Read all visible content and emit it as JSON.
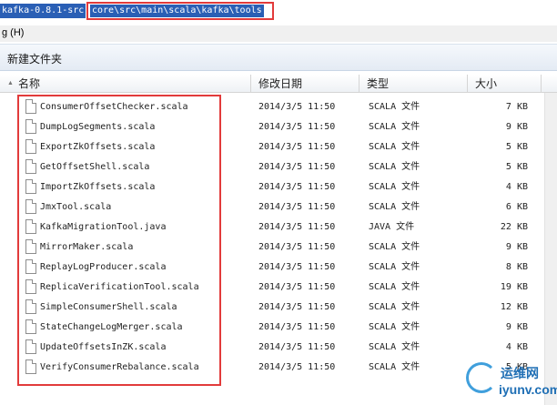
{
  "address_bar": {
    "path_prefix": "kafka-0.8.1-src",
    "path_highlight": "core\\src\\main\\scala\\kafka\\tools"
  },
  "menubar": {
    "help_label": "g (H)"
  },
  "toolbar": {
    "new_folder_label": "新建文件夹"
  },
  "columns": {
    "name": "名称",
    "date": "修改日期",
    "type": "类型",
    "size": "大小"
  },
  "files": [
    {
      "name": "ConsumerOffsetChecker.scala",
      "date": "2014/3/5 11:50",
      "type": "SCALA 文件",
      "size": "7 KB"
    },
    {
      "name": "DumpLogSegments.scala",
      "date": "2014/3/5 11:50",
      "type": "SCALA 文件",
      "size": "9 KB"
    },
    {
      "name": "ExportZkOffsets.scala",
      "date": "2014/3/5 11:50",
      "type": "SCALA 文件",
      "size": "5 KB"
    },
    {
      "name": "GetOffsetShell.scala",
      "date": "2014/3/5 11:50",
      "type": "SCALA 文件",
      "size": "5 KB"
    },
    {
      "name": "ImportZkOffsets.scala",
      "date": "2014/3/5 11:50",
      "type": "SCALA 文件",
      "size": "4 KB"
    },
    {
      "name": "JmxTool.scala",
      "date": "2014/3/5 11:50",
      "type": "SCALA 文件",
      "size": "6 KB"
    },
    {
      "name": "KafkaMigrationTool.java",
      "date": "2014/3/5 11:50",
      "type": "JAVA 文件",
      "size": "22 KB"
    },
    {
      "name": "MirrorMaker.scala",
      "date": "2014/3/5 11:50",
      "type": "SCALA 文件",
      "size": "9 KB"
    },
    {
      "name": "ReplayLogProducer.scala",
      "date": "2014/3/5 11:50",
      "type": "SCALA 文件",
      "size": "8 KB"
    },
    {
      "name": "ReplicaVerificationTool.scala",
      "date": "2014/3/5 11:50",
      "type": "SCALA 文件",
      "size": "19 KB"
    },
    {
      "name": "SimpleConsumerShell.scala",
      "date": "2014/3/5 11:50",
      "type": "SCALA 文件",
      "size": "12 KB"
    },
    {
      "name": "StateChangeLogMerger.scala",
      "date": "2014/3/5 11:50",
      "type": "SCALA 文件",
      "size": "9 KB"
    },
    {
      "name": "UpdateOffsetsInZK.scala",
      "date": "2014/3/5 11:50",
      "type": "SCALA 文件",
      "size": "4 KB"
    },
    {
      "name": "VerifyConsumerRebalance.scala",
      "date": "2014/3/5 11:50",
      "type": "SCALA 文件",
      "size": "5 KB"
    }
  ],
  "watermark": {
    "cn": "运维网",
    "en": "iyunv.com"
  },
  "colors": {
    "highlight": "#e23b3b",
    "selection": "#2a5fb5",
    "watermark": "#1f6fb5"
  }
}
